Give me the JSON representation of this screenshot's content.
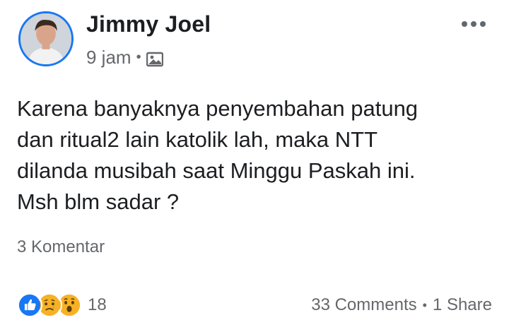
{
  "post": {
    "author": "Jimmy Joel",
    "time": "9 jam",
    "separator": "•",
    "audience_icon": "photo-audience-icon",
    "text_lines": [
      "Karena banyaknya penyembahan patung",
      "dan ritual2 lain katolik lah, maka NTT",
      "dilanda musibah saat Minggu Paskah ini.",
      "Msh blm sadar ?"
    ],
    "comment_link": "3 Komentar"
  },
  "footer": {
    "reaction_icons": [
      "like-icon",
      "sad-icon",
      "wow-icon"
    ],
    "reaction_count": "18",
    "comments": "33 Comments",
    "separator": "•",
    "shares": "1 Share"
  },
  "colors": {
    "accent": "#1877f2",
    "muted": "#65676b",
    "text": "#1c1e21",
    "emoji": "#f7b125"
  }
}
